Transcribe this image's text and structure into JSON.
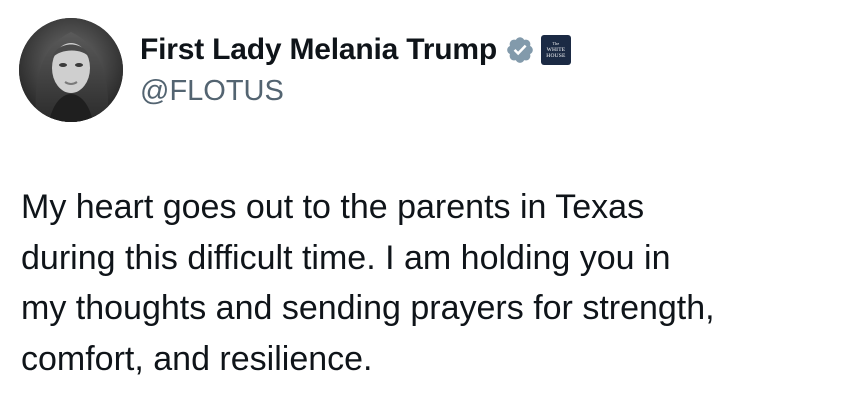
{
  "author": {
    "display_name": "First Lady Melania Trump",
    "handle": "@FLOTUS",
    "verified": true,
    "verified_badge_color": "#829aab",
    "affiliation_badge": {
      "icon": "white-house-badge-icon",
      "top_text": "The",
      "line1": "WHITE",
      "line2": "HOUSE",
      "color": "#1b2a44"
    },
    "avatar_icon": "profile-photo"
  },
  "tweet": {
    "lines": [
      "My heart goes out to the parents in Texas",
      "during this difficult time. I am holding you in",
      "my thoughts and sending prayers for strength,",
      "comfort, and resilience."
    ]
  }
}
